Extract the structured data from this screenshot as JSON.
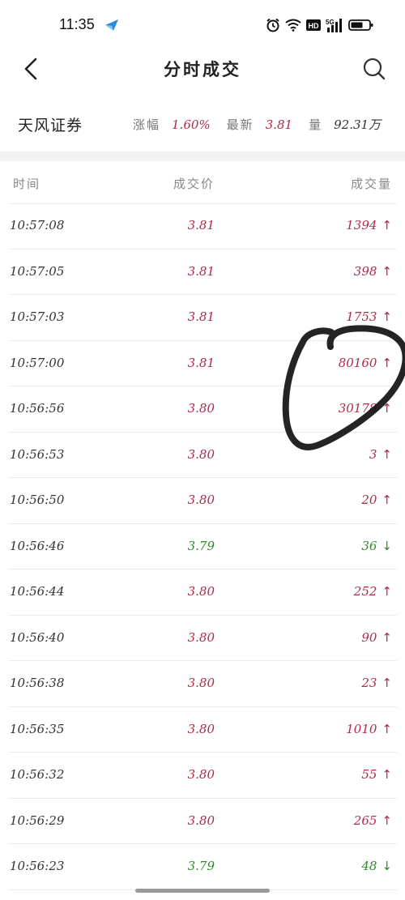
{
  "status_bar": {
    "time": "11:35",
    "icons": [
      "app-notification-icon",
      "alarm-icon",
      "wifi-icon",
      "hd-icon",
      "5g-signal-icon",
      "battery-icon"
    ],
    "hd_label": "HD",
    "network_label": "5G"
  },
  "nav": {
    "title": "分时成交",
    "back_icon": "chevron-left-icon",
    "search_icon": "search-icon"
  },
  "stock": {
    "name": "天风证券",
    "change_label": "涨幅",
    "change_value": "1.60%",
    "latest_label": "最新",
    "latest_value": "3.81",
    "volume_label": "量",
    "volume_value": "92.31万"
  },
  "table": {
    "headers": {
      "time": "时间",
      "price": "成交价",
      "volume": "成交量"
    },
    "rows": [
      {
        "time": "10:57:08",
        "price": "3.81",
        "volume": "1394",
        "direction": "up",
        "arrow": "↑"
      },
      {
        "time": "10:57:05",
        "price": "3.81",
        "volume": "398",
        "direction": "up",
        "arrow": "↑"
      },
      {
        "time": "10:57:03",
        "price": "3.81",
        "volume": "1753",
        "direction": "up",
        "arrow": "↑"
      },
      {
        "time": "10:57:00",
        "price": "3.81",
        "volume": "80160",
        "direction": "up",
        "arrow": "↑"
      },
      {
        "time": "10:56:56",
        "price": "3.80",
        "volume": "30178",
        "direction": "up",
        "arrow": "↑"
      },
      {
        "time": "10:56:53",
        "price": "3.80",
        "volume": "3",
        "direction": "up",
        "arrow": "↑"
      },
      {
        "time": "10:56:50",
        "price": "3.80",
        "volume": "20",
        "direction": "up",
        "arrow": "↑"
      },
      {
        "time": "10:56:46",
        "price": "3.79",
        "volume": "36",
        "direction": "down",
        "arrow": "↓"
      },
      {
        "time": "10:56:44",
        "price": "3.80",
        "volume": "252",
        "direction": "up",
        "arrow": "↑"
      },
      {
        "time": "10:56:40",
        "price": "3.80",
        "volume": "90",
        "direction": "up",
        "arrow": "↑"
      },
      {
        "time": "10:56:38",
        "price": "3.80",
        "volume": "23",
        "direction": "up",
        "arrow": "↑"
      },
      {
        "time": "10:56:35",
        "price": "3.80",
        "volume": "1010",
        "direction": "up",
        "arrow": "↑"
      },
      {
        "time": "10:56:32",
        "price": "3.80",
        "volume": "55",
        "direction": "up",
        "arrow": "↑"
      },
      {
        "time": "10:56:29",
        "price": "3.80",
        "volume": "265",
        "direction": "up",
        "arrow": "↑"
      },
      {
        "time": "10:56:23",
        "price": "3.79",
        "volume": "48",
        "direction": "down",
        "arrow": "↓"
      }
    ]
  },
  "colors": {
    "up": "#b12a4a",
    "down": "#2e8a2e",
    "annotation": "#111111"
  }
}
